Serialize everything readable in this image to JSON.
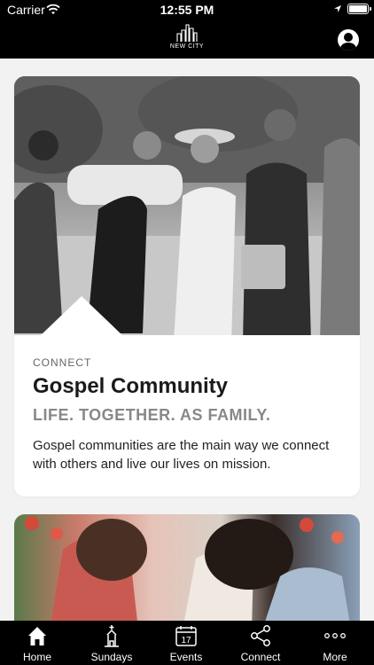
{
  "status_bar": {
    "carrier": "Carrier",
    "time": "12:55 PM"
  },
  "header": {
    "logo_text": "NEW CITY",
    "icons": [
      "city-logo-icon",
      "profile-icon"
    ]
  },
  "card": {
    "kicker": "CONNECT",
    "title": "Gospel Community",
    "subtitle": "LIFE. TOGETHER. AS FAMILY.",
    "description": "Gospel communities are the main way we connect with others and live our lives on mission."
  },
  "tabs": [
    {
      "label": "Home",
      "icon": "home-icon"
    },
    {
      "label": "Sundays",
      "icon": "church-icon"
    },
    {
      "label": "Events",
      "icon": "calendar-icon"
    },
    {
      "label": "Connect",
      "icon": "share-icon"
    },
    {
      "label": "More",
      "icon": "more-icon"
    }
  ],
  "calendar_day": "17",
  "colors": {
    "bar_background": "#000000",
    "page_background": "#f2f2f2",
    "card_background": "#ffffff",
    "title": "#1a1a1a",
    "subtitle": "#888888"
  }
}
